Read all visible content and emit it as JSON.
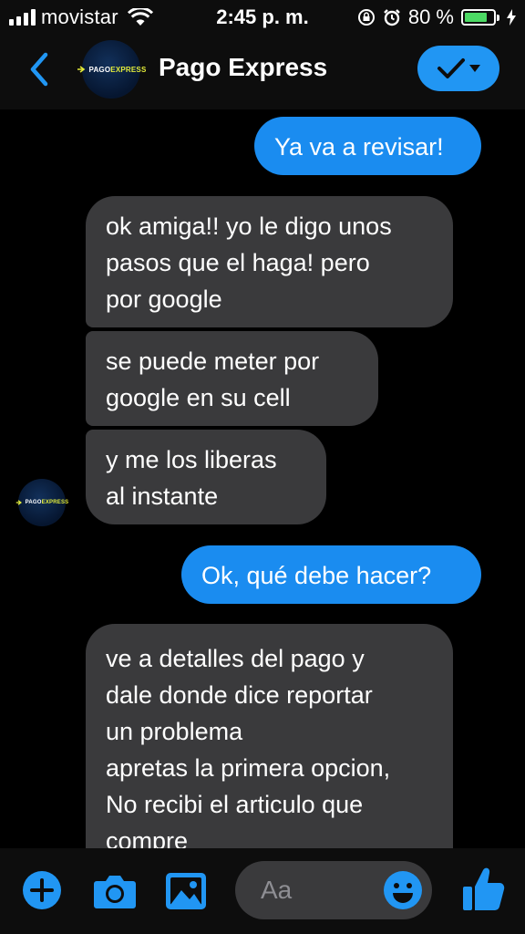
{
  "status": {
    "carrier": "movistar",
    "time": "2:45 p. m.",
    "battery_pct_label": "80 %",
    "battery_level": 0.8
  },
  "header": {
    "contact_name": "Pago Express",
    "logo_text_a": "PAGO",
    "logo_text_b": "EXPRESS"
  },
  "messages": [
    {
      "side": "out",
      "text": "Ya va a revisar!"
    },
    {
      "side": "in",
      "text": "ok amiga!! yo le digo unos\npasos que el haga! pero\npor google"
    },
    {
      "side": "in",
      "text": "se puede meter por\ngoogle en su cell"
    },
    {
      "side": "in",
      "text": "y me los liberas\nal instante"
    },
    {
      "side": "out",
      "text": "Ok, qué debe hacer?"
    },
    {
      "side": "in",
      "text": "ve a detalles del pago y\ndale donde dice reportar\nun problema\napretas la primera opcion,\nNo recibi el articulo que\ncompre"
    }
  ],
  "composer": {
    "placeholder": "Aa",
    "icons": [
      "plus-icon",
      "camera-icon",
      "gallery-icon",
      "emoji-icon",
      "thumbs-up-icon"
    ]
  },
  "colors": {
    "accent": "#1a8cf0",
    "incoming_bubble": "#3a3a3c",
    "background": "#000000",
    "battery": "#4cd964"
  }
}
